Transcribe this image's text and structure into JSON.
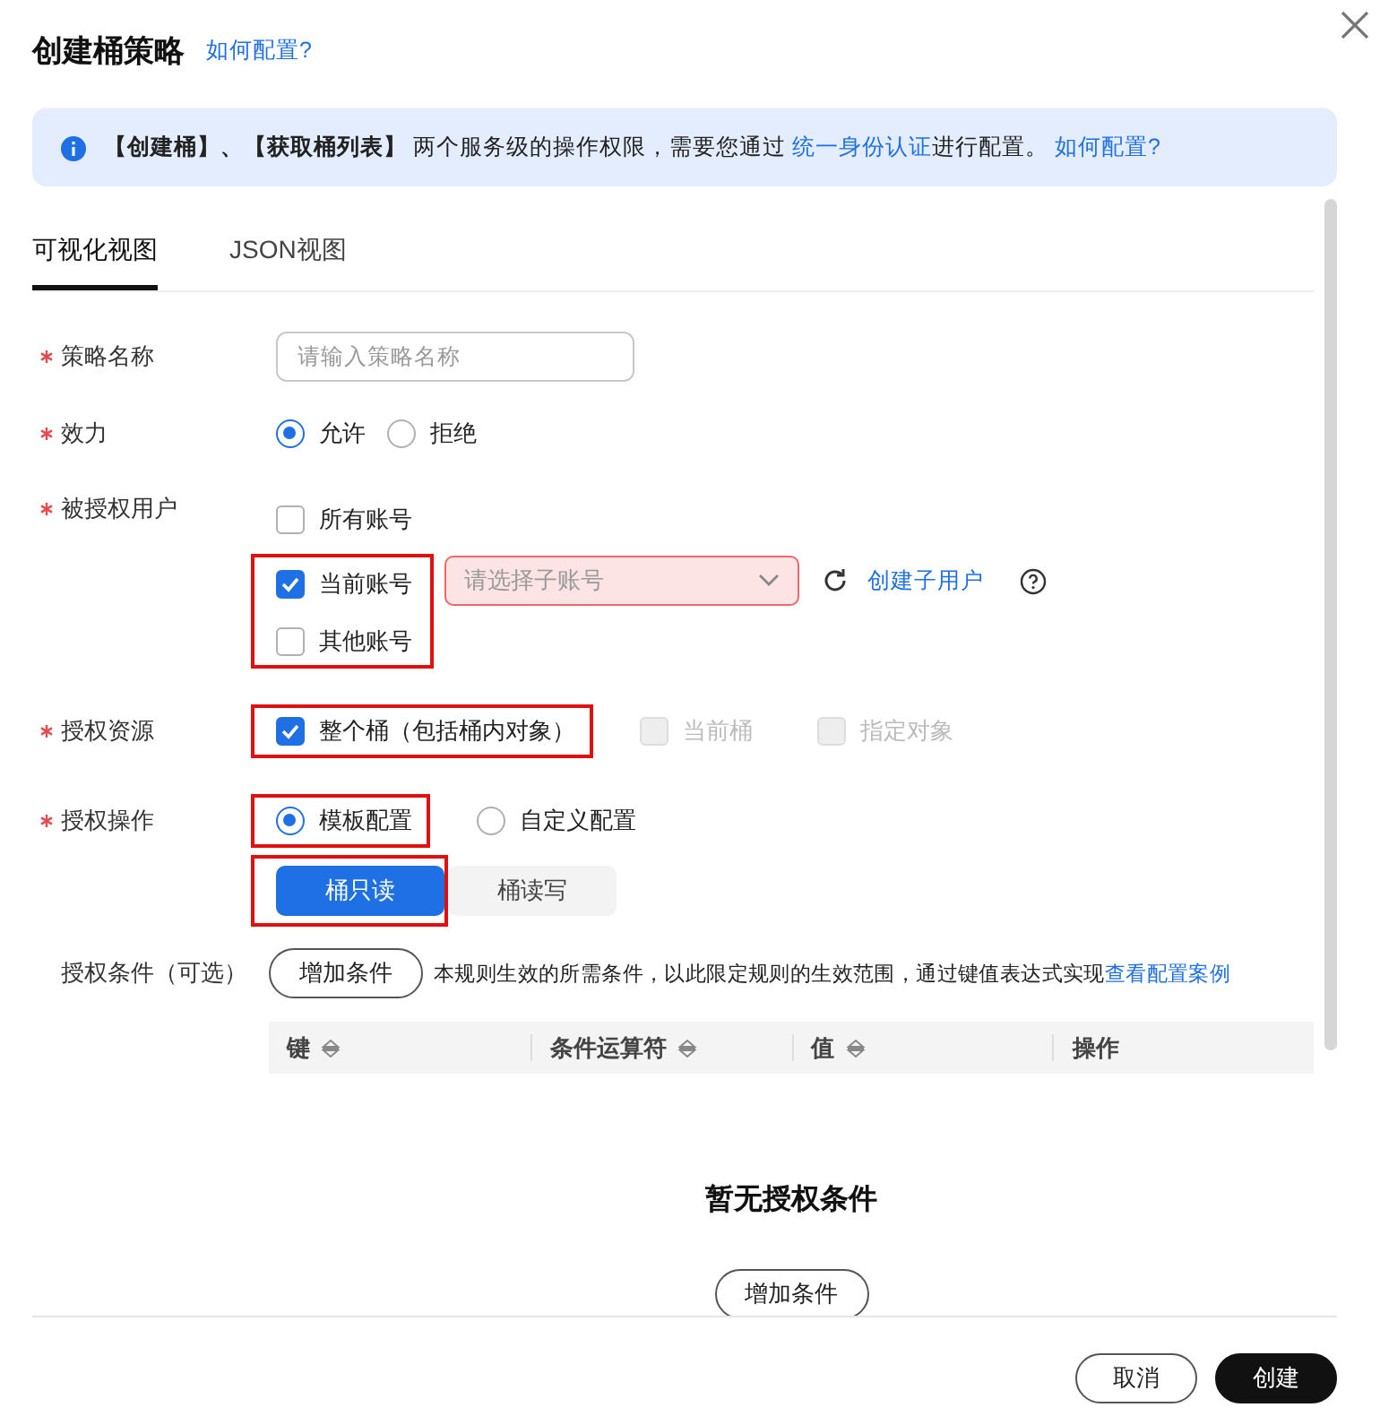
{
  "dialog": {
    "title": "创建桶策略",
    "help_link": "如何配置?"
  },
  "notice": {
    "text": "**【创建桶】、【获取桶列表】** 两个服务级的操作权限，需要您通过 ",
    "link": "统一身份认证",
    "after": "进行配置。",
    "help_link": "如何配置?"
  },
  "tabs": [
    {
      "label": "可视化视图",
      "selected": true
    },
    {
      "label": "JSON视图",
      "selected": false
    }
  ],
  "policy_name": {
    "label": "策略名称",
    "required": true,
    "placeholder": "请输入策略名称"
  },
  "effect": {
    "label": "效力",
    "required": true,
    "options": [
      {
        "label": "允许",
        "selected": true
      },
      {
        "label": "拒绝",
        "selected": false
      }
    ]
  },
  "users": {
    "label": "被授权用户",
    "required": true,
    "options": [
      {
        "label": "所有账号",
        "checked": false
      }
    ],
    "group": {
      "highlighted": true,
      "options": [
        {
          "label": "当前账号",
          "checked": true
        },
        {
          "label": "其他账号",
          "checked": false
        }
      ]
    },
    "select": {
      "placeholder": "请选择子账号",
      "invalid": true
    },
    "create_link": "创建子用户"
  },
  "resource": {
    "label": "授权资源",
    "required": true,
    "options": [
      {
        "label": "整个桶（包括桶内对象）",
        "checked": true,
        "disabled": false,
        "highlighted": true
      },
      {
        "label": "当前桶",
        "checked": false,
        "disabled": true,
        "highlighted": false
      },
      {
        "label": "指定对象",
        "checked": false,
        "disabled": true,
        "highlighted": false
      }
    ]
  },
  "operation": {
    "label": "授权操作",
    "required": true,
    "options": [
      {
        "label": "模板配置",
        "selected": true,
        "highlighted": true
      },
      {
        "label": "自定义配置",
        "selected": false,
        "highlighted": false
      }
    ],
    "templates": [
      {
        "label": "桶只读",
        "selected": true,
        "highlighted": true
      },
      {
        "label": "桶读写",
        "selected": false,
        "highlighted": false
      }
    ]
  },
  "conditions": {
    "label": "授权条件（可选）",
    "add_button": "增加条件",
    "description": "本规则生效的所需条件，以此限定规则的生效范围，通过键值表达式实现",
    "link": "查看配置案例",
    "columns": [
      {
        "label": "键",
        "sortable": true
      },
      {
        "label": "条件运算符",
        "sortable": true
      },
      {
        "label": "值",
        "sortable": true
      },
      {
        "label": "操作",
        "sortable": false
      }
    ],
    "empty_text": "暂无授权条件",
    "empty_button": "增加条件"
  },
  "footer_buttons": [
    {
      "label": "取消",
      "kind": "secondary"
    },
    {
      "label": "创建",
      "kind": "primary"
    }
  ]
}
